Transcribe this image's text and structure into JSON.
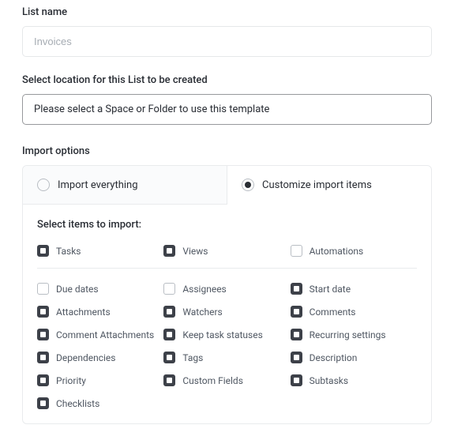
{
  "list_name": {
    "label": "List name",
    "placeholder": "Invoices",
    "value": ""
  },
  "location": {
    "label": "Select location for this List to be created",
    "placeholder": "Please select a Space or Folder to use this template"
  },
  "import_options": {
    "label": "Import options",
    "tabs": {
      "everything": {
        "label": "Import everything",
        "selected": false
      },
      "customize": {
        "label": "Customize import items",
        "selected": true
      }
    },
    "select_items_label": "Select items to import:",
    "top_row": [
      {
        "key": "tasks",
        "label": "Tasks",
        "checked": true
      },
      {
        "key": "views",
        "label": "Views",
        "checked": true
      },
      {
        "key": "automations",
        "label": "Automations",
        "checked": false
      }
    ],
    "columns": [
      [
        {
          "key": "due_dates",
          "label": "Due dates",
          "checked": false
        },
        {
          "key": "attachments",
          "label": "Attachments",
          "checked": true
        },
        {
          "key": "comment_attachments",
          "label": "Comment Attachments",
          "checked": true
        },
        {
          "key": "dependencies",
          "label": "Dependencies",
          "checked": true
        },
        {
          "key": "priority",
          "label": "Priority",
          "checked": true
        },
        {
          "key": "checklists",
          "label": "Checklists",
          "checked": true
        }
      ],
      [
        {
          "key": "assignees",
          "label": "Assignees",
          "checked": false
        },
        {
          "key": "watchers",
          "label": "Watchers",
          "checked": true
        },
        {
          "key": "keep_task_statuses",
          "label": "Keep task statuses",
          "checked": true
        },
        {
          "key": "tags",
          "label": "Tags",
          "checked": true
        },
        {
          "key": "custom_fields",
          "label": "Custom Fields",
          "checked": true
        }
      ],
      [
        {
          "key": "start_date",
          "label": "Start date",
          "checked": true
        },
        {
          "key": "comments",
          "label": "Comments",
          "checked": true
        },
        {
          "key": "recurring_settings",
          "label": "Recurring settings",
          "checked": true
        },
        {
          "key": "description",
          "label": "Description",
          "checked": true
        },
        {
          "key": "subtasks",
          "label": "Subtasks",
          "checked": true
        }
      ]
    ]
  }
}
